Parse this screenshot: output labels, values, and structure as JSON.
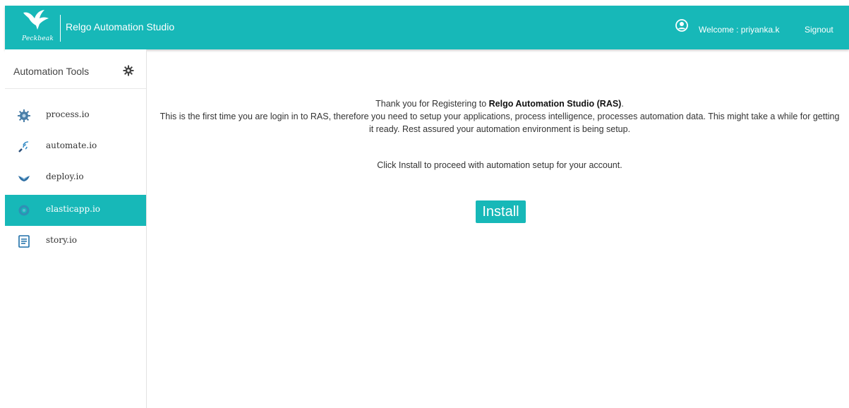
{
  "header": {
    "logo_text": "Peckbeak",
    "app_title": "Relgo Automation Studio",
    "welcome": "Welcome : priyanka.k",
    "signout": "Signout",
    "bg_color": "#17b8b8"
  },
  "sidebar": {
    "title": "Automation Tools",
    "items": [
      {
        "label": "process.io",
        "icon": "process-icon"
      },
      {
        "label": "automate.io",
        "icon": "automate-icon"
      },
      {
        "label": "deploy.io",
        "icon": "deploy-icon"
      },
      {
        "label": "elasticapp.io",
        "icon": "elasticapp-icon",
        "active": true
      },
      {
        "label": "story.io",
        "icon": "story-icon"
      }
    ]
  },
  "main": {
    "message_prefix": "Thank you for Registering to ",
    "message_bold": "Relgo Automation Studio (RAS)",
    "message_suffix": ".",
    "message_body": "This is the first time you are login in to RAS, therefore you need to setup your applications, process intelligence, processes automation data. This might take a while for getting it ready. Rest assured your automation environment is being setup.",
    "click_text": "Click Install to proceed with automation setup for your account.",
    "install_label": "Install"
  }
}
